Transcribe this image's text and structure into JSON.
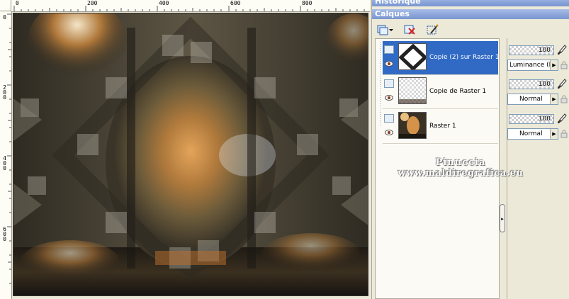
{
  "panels": {
    "history_title": "Historique",
    "layers_title": "Calques"
  },
  "rulers": {
    "top": [
      "0",
      "200",
      "400",
      "600",
      "800"
    ],
    "left": [
      "0",
      "2 0 0",
      "4 0 0",
      "6 0 0"
    ]
  },
  "layers": [
    {
      "name": "Copie (2) sur Raster 1",
      "opacity": "100",
      "blend": "Luminance (H)",
      "selected": true
    },
    {
      "name": "Copie de Raster 1",
      "opacity": "100",
      "blend": "Normal",
      "selected": false
    },
    {
      "name": "Raster 1",
      "opacity": "100",
      "blend": "Normal",
      "selected": false
    }
  ],
  "watermark": {
    "line1": "Pinuccia",
    "line2": "www.maldiregrafica.eu"
  },
  "icons": [
    "new-layer-icon",
    "dropdown-arrow-icon",
    "delete-layer-icon",
    "mask-icon",
    "eye-icon",
    "brush-icon",
    "lock-icon",
    "layer-type-icon"
  ]
}
